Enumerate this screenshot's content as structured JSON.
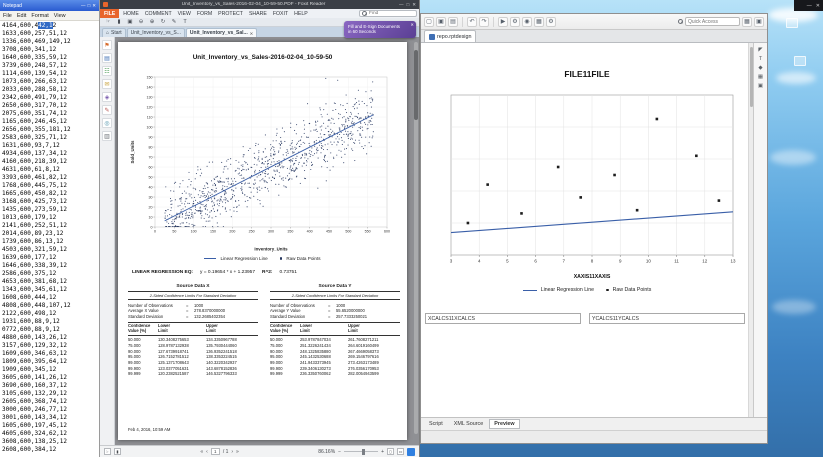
{
  "colors": {
    "foxit_file_tab": "#e8652c",
    "promo_purple": "#6b4fa1",
    "selection_blue": "#316ac5",
    "notepad_title_blue": "#2a5bd0",
    "regression_line": "#3a5fa8",
    "scatter_point": "#25355e",
    "sky_top": "#b7e2f8",
    "sky_bottom": "#336fa9"
  },
  "misc": {
    "min_glyph": "—",
    "max_glyph": "□",
    "close_glyph": "✕"
  },
  "notepad": {
    "title": "Notepad",
    "menu": [
      "File",
      "Edit",
      "Format",
      "View"
    ],
    "selection": {
      "pre": "4164,600,4",
      "selected": "42,1",
      "post": "2"
    },
    "lines": [
      "4164,600,442,12",
      "1633,600,257,51,12",
      "1336,600,469,149,12",
      "3708,600,341,12",
      "1640,600,335,59,12",
      "3739,600,248,57,12",
      "1114,600,139,54,12",
      "1073,600,266,63,12",
      "2033,600,288,58,12",
      "2342,600,491,79,12",
      "2650,600,317,70,12",
      "2075,600,351,74,12",
      "1165,600,246,45,12",
      "2656,600,355,181,12",
      "2583,600,325,71,12",
      "1631,600,93,7,12",
      "4934,600,137,34,12",
      "4160,600,218,39,12",
      "4631,600,61,8,12",
      "3393,600,461,82,12",
      "1768,600,445,75,12",
      "1665,600,450,82,12",
      "3168,600,425,73,12",
      "1435,600,273,59,12",
      "1013,600,179,12",
      "2141,600,252,51,12",
      "2014,600,89,23,12",
      "1739,600,86,13,12",
      "4503,600,321,59,12",
      "1639,600,177,12",
      "1646,600,338,39,12",
      "2586,600,375,12",
      "4653,600,381,68,12",
      "1343,600,345,61,12",
      "1608,600,444,12",
      "4808,600,448,107,12",
      "2122,600,498,12",
      "1931,600,88,9,12",
      "0772,600,88,9,12",
      "4880,600,143,26,12",
      "3157,600,129,32,12",
      "1609,600,346,63,12",
      "1809,600,395,64,12",
      "1909,600,345,12",
      "3605,600,141,26,12",
      "3690,600,160,37,12",
      "3105,600,132,29,12",
      "2605,600,368,74,12",
      "3000,600,246,77,12",
      "3001,600,143,34,12",
      "1605,600,197,45,12",
      "4605,600,324,62,12",
      "3608,600,138,25,12",
      "2608,600,384,12"
    ]
  },
  "foxit": {
    "window_title": "Unit_Inventory_vs_Sales-2016-02-04_10-59-50.PDF - Foxit Reader",
    "file_tab": "FILE",
    "ribbon_tabs": [
      "HOME",
      "COMMENT",
      "VIEW",
      "FORM",
      "PROTECT",
      "SHARE",
      "FOXIT",
      "HELP"
    ],
    "find_placeholder": "Find",
    "ribbon_icons": [
      "hand-tool",
      "select-text",
      "snapshot",
      "zoom-out",
      "zoom-in",
      "rotate-view",
      "highlight",
      "typewriter"
    ],
    "doc_tabs": [
      {
        "label": "Start",
        "icon": "home",
        "active": false
      },
      {
        "label": "Unit_Inventory_vs_S...",
        "active": false
      },
      {
        "label": "Unit_Inventory_vs_Sal...",
        "active": true,
        "close": "✕"
      }
    ],
    "promo": {
      "line1": "Fill and E-Sign Documents",
      "line2": "in 60 Seconds",
      "close": "✕"
    },
    "side_icons": [
      "bookmarks",
      "pages",
      "layers",
      "comments",
      "attachments",
      "signature",
      "search",
      "clipboard"
    ],
    "status": {
      "first": "«",
      "prev": "‹",
      "page_current": "1",
      "page_total": "/ 1",
      "next": "›",
      "last": "»",
      "zoom_out": "−",
      "zoom": "86.16%",
      "zoom_in": "+"
    }
  },
  "pdf": {
    "title": "Unit_Inventory_vs_Sales-2016-02-04_10-59-50",
    "eq_label": "LINEAR REGRESSION EQ:",
    "equation": "y = 0.19654 * x + 1.23957",
    "r2_label": "R^2:",
    "r2_value": "0.73751",
    "footer": "Feb 4, 2016, 10:59 AM",
    "columns": [
      {
        "header": "Source Data X",
        "subtitle": "2-Sided Confidence Limits For Standard Deviation",
        "stats": [
          {
            "label": "Number of Observations",
            "eq": "=",
            "value": "1000"
          },
          {
            "label": "Average X Value",
            "eq": "=",
            "value": "278.8370000000"
          },
          {
            "label": "Standard Deviation",
            "eq": "=",
            "value": "132.2685402354"
          }
        ],
        "table_headers": [
          "Confidence\nValue (%)",
          "Lower\nLimit",
          "Upper\nLimit"
        ],
        "rows": [
          [
            "50.000",
            "130.3408275653",
            "134.3350967788"
          ],
          [
            "75.000",
            "128.9787132938",
            "135.7930444060"
          ],
          [
            "90.000",
            "127.6739918741",
            "136.9352241518"
          ],
          [
            "95.000",
            "126.7152781512",
            "138.3353224515"
          ],
          [
            "99.000",
            "125.1371708643",
            "140.3220342937"
          ],
          [
            "99.900",
            "123.0377051631",
            "143.6878152836"
          ],
          [
            "99.999",
            "120.2382521587",
            "146.5327796333"
          ]
        ]
      },
      {
        "header": "Source Data Y",
        "subtitle": "2-Sided Confidence Limits For Standard Deviation",
        "stats": [
          {
            "label": "Number of Observations",
            "eq": "=",
            "value": "1000"
          },
          {
            "label": "Average Y Value",
            "eq": "=",
            "value": "55.6520000000"
          },
          {
            "label": "Standard Deviation",
            "eq": "=",
            "value": "257.7333250021"
          }
        ],
        "table_headers": [
          "Confidence\nValue (%)",
          "Lower\nLimit",
          "Upper\nLimit"
        ],
        "rows": [
          [
            "50.000",
            "253.9787847034",
            "261.7608271211"
          ],
          [
            "75.000",
            "251.3226241434",
            "264.6019160499"
          ],
          [
            "90.000",
            "248.1325835880",
            "267.4669058373"
          ],
          [
            "95.000",
            "245.1432530688",
            "269.1546797616"
          ],
          [
            "99.000",
            "241.9433373945",
            "273.4263173489"
          ],
          [
            "99.900",
            "239.3406130273",
            "276.0356170953"
          ],
          [
            "99.999",
            "236.3350760062",
            "282.0054943599"
          ]
        ]
      }
    ]
  },
  "designer": {
    "quick_access_placeholder": "Quick Access",
    "tab_label": "repo.rptdesign",
    "canvas_title": "FILE11FILE",
    "fields": [
      "XCALCS11XCALCS",
      "YCALCS11YCALCS"
    ],
    "bottom_tabs": [
      {
        "label": "Script",
        "active": false
      },
      {
        "label": "XML Source",
        "active": false
      },
      {
        "label": "Preview",
        "active": true
      }
    ],
    "toolbar_icons": [
      "new",
      "save",
      "print",
      "undo",
      "redo",
      "run",
      "debug",
      "preview",
      "palette",
      "settings"
    ],
    "palette_icons": [
      "cursor",
      "text",
      "shapes",
      "grid",
      "image"
    ]
  },
  "chart_data": [
    {
      "id": "pdf_scatter",
      "type": "scatter",
      "title": "Unit_Inventory_vs_Sales-2016-02-04_10-59-50",
      "xlabel": "Inventory_Units",
      "ylabel": "Sold_Units",
      "xlim": [
        0,
        600
      ],
      "xtick_step": 50,
      "ylim": [
        0,
        150
      ],
      "ytick_step": 10,
      "grid": true,
      "legend": [
        "Linear Regression Line",
        "Raw Data Points"
      ],
      "legend_position": "bottom",
      "regression": {
        "slope": 0.19654,
        "intercept": 1.23957,
        "r2": 0.73751
      },
      "points": {
        "count": 1000,
        "x_min": 25,
        "x_max": 565,
        "noise_sd": 15.5,
        "seed": 42
      },
      "line_color": "#3a5fa8",
      "point_color": "#25355e"
    },
    {
      "id": "designer_scatter",
      "type": "scatter",
      "title": "FILE11FILE",
      "xlabel": "XAXIS11XAXIS",
      "xlim": [
        3,
        13
      ],
      "xticks": [
        3,
        4,
        5,
        6,
        7,
        8,
        9,
        10,
        11,
        12,
        13
      ],
      "ylim": [
        0,
        1
      ],
      "ygrid_step": 0.2,
      "grid": true,
      "legend": [
        "Linear Regression Line",
        "Raw Data Points"
      ],
      "legend_position": "bottom",
      "line": {
        "x1": 3,
        "y1": 0.14,
        "x2": 13,
        "y2": 0.27
      },
      "points_xy": [
        [
          3.6,
          0.2
        ],
        [
          4.3,
          0.44
        ],
        [
          5.5,
          0.26
        ],
        [
          6.8,
          0.55
        ],
        [
          7.6,
          0.36
        ],
        [
          8.8,
          0.5
        ],
        [
          9.6,
          0.28
        ],
        [
          10.3,
          0.85
        ],
        [
          11.7,
          0.62
        ],
        [
          12.5,
          0.34
        ]
      ],
      "line_color": "#3a5fa8",
      "point_color": "#1d1d1d"
    }
  ]
}
